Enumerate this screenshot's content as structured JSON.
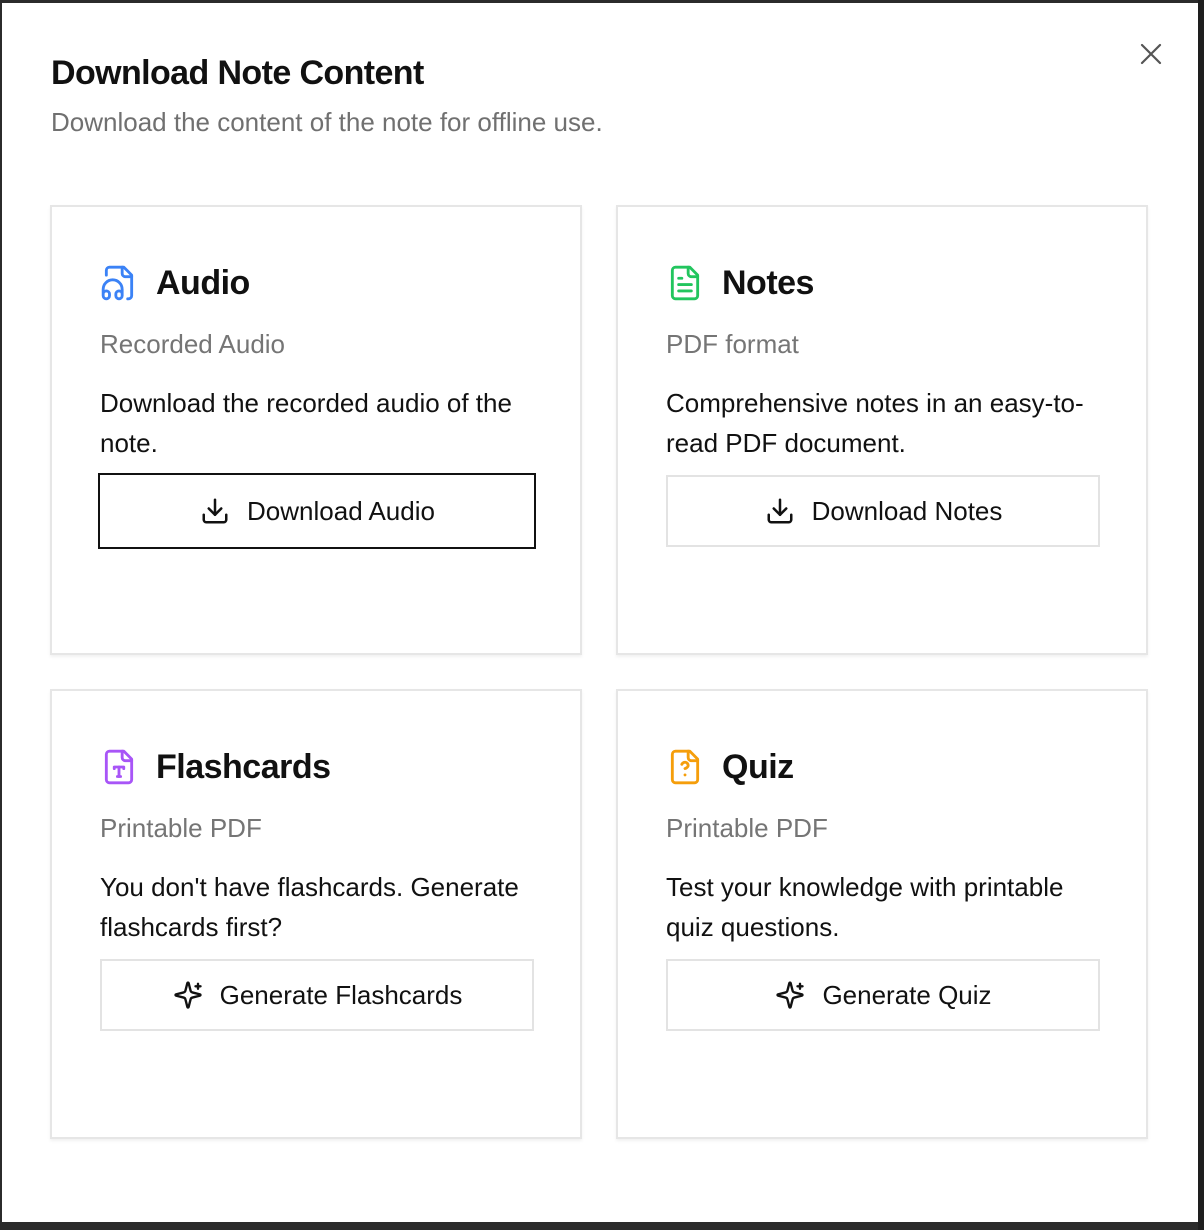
{
  "dialog": {
    "title": "Download Note Content",
    "subtitle": "Download the content of the note for offline use.",
    "close_icon": "close-icon"
  },
  "cards": [
    {
      "icon": "file-audio-icon",
      "icon_color": "#3b82f6",
      "title": "Audio",
      "subtitle": "Recorded Audio",
      "description": "Download the recorded audio of the note.",
      "button_label": "Download Audio",
      "button_icon": "download-icon"
    },
    {
      "icon": "file-text-icon",
      "icon_color": "#22c55e",
      "title": "Notes",
      "subtitle": "PDF format",
      "description": "Comprehensive notes in an easy-to-read PDF document.",
      "button_label": "Download Notes",
      "button_icon": "download-icon"
    },
    {
      "icon": "file-type-icon",
      "icon_color": "#a855f7",
      "title": "Flashcards",
      "subtitle": "Printable PDF",
      "description": "You don't have flashcards. Generate flashcards first?",
      "button_label": "Generate Flashcards",
      "button_icon": "sparkles-icon"
    },
    {
      "icon": "file-question-icon",
      "icon_color": "#f59e0b",
      "title": "Quiz",
      "subtitle": "Printable PDF",
      "description": "Test your knowledge with printable quiz questions.",
      "button_label": "Generate Quiz",
      "button_icon": "sparkles-icon"
    }
  ]
}
